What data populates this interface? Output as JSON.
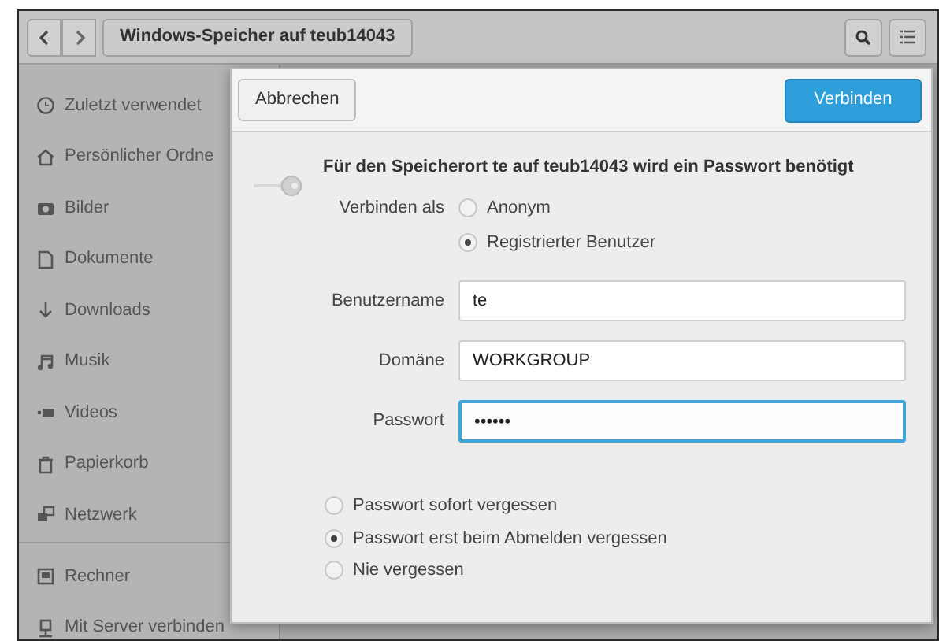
{
  "window": {
    "title": "Windows-Speicher auf teub14043"
  },
  "sidebar": {
    "groups": [
      [
        {
          "label": "Zuletzt verwendet"
        },
        {
          "label": "Persönlicher Ordne"
        },
        {
          "label": "Bilder"
        },
        {
          "label": "Dokumente"
        },
        {
          "label": "Downloads"
        },
        {
          "label": "Musik"
        },
        {
          "label": "Videos"
        },
        {
          "label": "Papierkorb"
        },
        {
          "label": "Netzwerk"
        }
      ],
      [
        {
          "label": "Rechner"
        },
        {
          "label": "Mit Server verbinden"
        }
      ]
    ]
  },
  "dialog": {
    "cancel": "Abbrechen",
    "connect": "Verbinden",
    "heading": "Für den Speicherort te auf teub14043 wird ein Passwort benötigt",
    "connect_as": {
      "label": "Verbinden als",
      "options": [
        {
          "label": "Anonym",
          "selected": false
        },
        {
          "label": "Registrierter Benutzer",
          "selected": true
        }
      ]
    },
    "fields": [
      {
        "label": "Benutzername",
        "value": "te",
        "focused": false
      },
      {
        "label": "Domäne",
        "value": "WORKGROUP",
        "focused": false
      },
      {
        "label": "Passwort",
        "value": "••••••",
        "focused": true
      }
    ],
    "remember": [
      {
        "label": "Passwort sofort vergessen",
        "selected": false
      },
      {
        "label": "Passwort erst beim Abmelden vergessen",
        "selected": true
      },
      {
        "label": "Nie vergessen",
        "selected": false
      }
    ]
  }
}
